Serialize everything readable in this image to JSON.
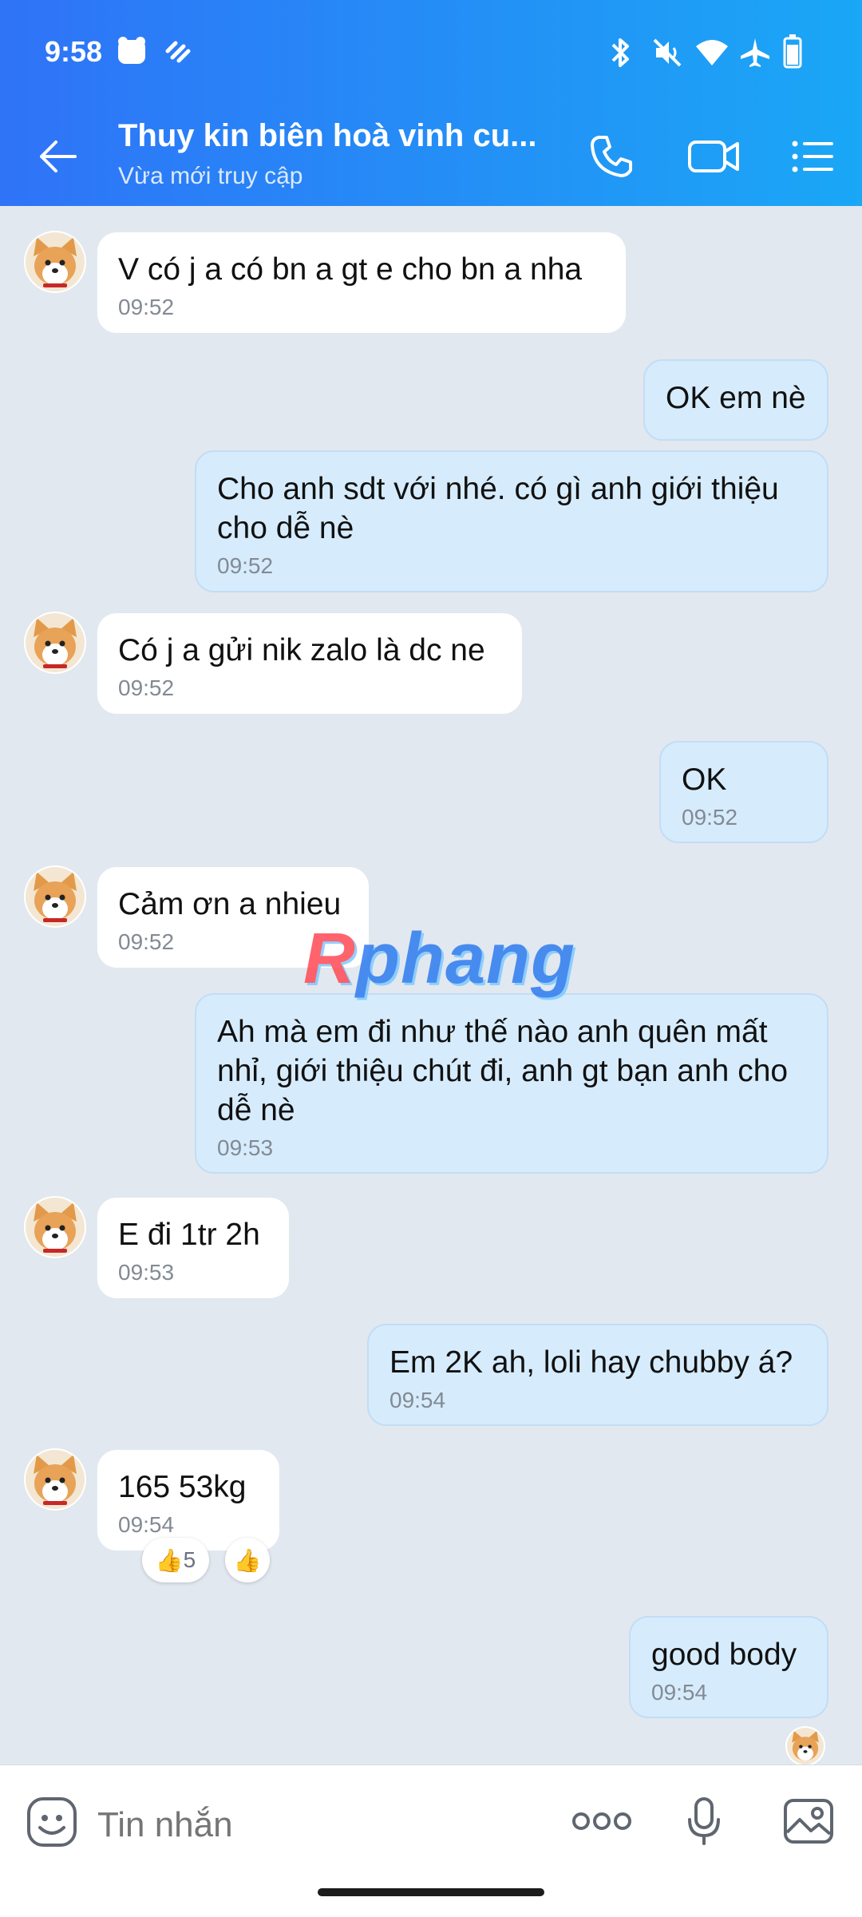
{
  "status_bar": {
    "time": "9:58"
  },
  "header": {
    "title": "Thuy kin biên hoà vinh cu...",
    "subtitle": "Vừa mới truy cập"
  },
  "messages": [
    {
      "side": "in",
      "text": "V có j a có bn a gt e cho bn a nha",
      "time": "09:52"
    },
    {
      "side": "out",
      "text": "OK em nè",
      "time": ""
    },
    {
      "side": "out",
      "text": "Cho anh sdt với nhé. có gì anh giới thiệu cho dễ nè",
      "time": "09:52"
    },
    {
      "side": "in",
      "text": "Có j a gửi nik zalo là dc ne",
      "time": "09:52"
    },
    {
      "side": "out",
      "text": "OK",
      "time": "09:52"
    },
    {
      "side": "in",
      "text": "Cảm ơn a nhieu",
      "time": "09:52"
    },
    {
      "side": "out",
      "text": "Ah mà em đi như thế nào anh quên mất nhỉ, giới thiệu chút đi, anh gt bạn anh cho dễ nè",
      "time": "09:53"
    },
    {
      "side": "in",
      "text": "E đi 1tr 2h",
      "time": "09:53"
    },
    {
      "side": "out",
      "text": "Em 2K ah, loli hay chubby á?",
      "time": "09:54"
    },
    {
      "side": "in",
      "text": "165 53kg",
      "time": "09:54"
    },
    {
      "side": "out",
      "text": "good body",
      "time": "09:54"
    }
  ],
  "reactions": {
    "summary_count": "5",
    "summary_emoji": "👍",
    "add_emoji": "👍"
  },
  "watermark": {
    "prefix": "R",
    "rest": "phang"
  },
  "composer": {
    "placeholder": "Tin nhắn"
  }
}
